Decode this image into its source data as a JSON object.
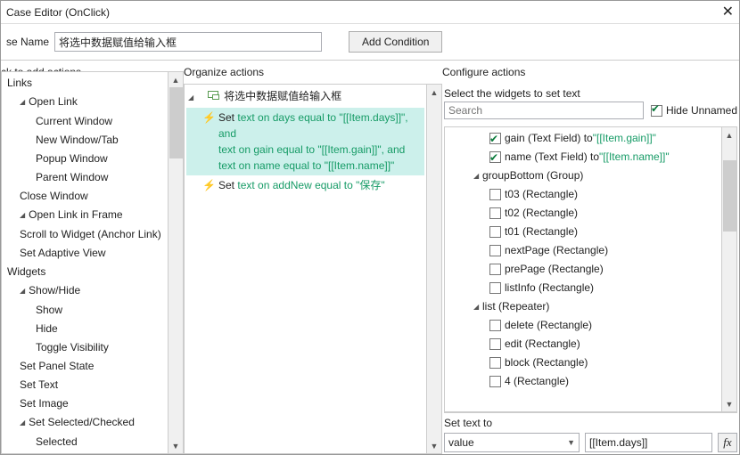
{
  "window": {
    "title": "Case Editor (OnClick)"
  },
  "caseRow": {
    "label": "se Name",
    "value": "将选中数据赋值给输入框",
    "addCondition": "Add Condition"
  },
  "left": {
    "heading": "ck to add actions",
    "groups": [
      {
        "label": "Links",
        "lvl": 1
      },
      {
        "label": "Open Link",
        "lvl": 2,
        "children": true
      },
      {
        "label": "Current Window",
        "lvl": 3
      },
      {
        "label": "New Window/Tab",
        "lvl": 3
      },
      {
        "label": "Popup Window",
        "lvl": 3
      },
      {
        "label": "Parent Window",
        "lvl": 3
      },
      {
        "label": "Close Window",
        "lvl": 2
      },
      {
        "label": "Open Link in Frame",
        "lvl": 2,
        "children": true
      },
      {
        "label": "Scroll to Widget (Anchor Link)",
        "lvl": 2
      },
      {
        "label": "Set Adaptive View",
        "lvl": 2
      },
      {
        "label": "Widgets",
        "lvl": 1
      },
      {
        "label": "Show/Hide",
        "lvl": 2,
        "children": true
      },
      {
        "label": "Show",
        "lvl": 3
      },
      {
        "label": "Hide",
        "lvl": 3
      },
      {
        "label": "Toggle Visibility",
        "lvl": 3
      },
      {
        "label": "Set Panel State",
        "lvl": 2
      },
      {
        "label": "Set Text",
        "lvl": 2
      },
      {
        "label": "Set Image",
        "lvl": 2
      },
      {
        "label": "Set Selected/Checked",
        "lvl": 2,
        "children": true
      },
      {
        "label": "Selected",
        "lvl": 3
      }
    ]
  },
  "mid": {
    "heading": "Organize actions",
    "caseName": "将选中数据赋值给输入框",
    "items": [
      {
        "sel": true,
        "pre": "Set ",
        "lines": [
          "text on days equal to \"[[Item.days]]\", and",
          "text on gain equal to \"[[Item.gain]]\", and",
          "text on name equal to \"[[Item.name]]\""
        ]
      },
      {
        "sel": false,
        "pre": "Set ",
        "lines": [
          "text on addNew equal to \"保存\""
        ]
      }
    ]
  },
  "right": {
    "heading": "Configure actions",
    "sub1": "Select the widgets to set text",
    "searchPlaceholder": "Search",
    "hideUnnamed": "Hide Unnamed",
    "widgets": [
      {
        "type": "row",
        "lvl": 2,
        "checked": true,
        "pre": "gain (Text Field) to ",
        "vq": "\"[[Item.gain]]\""
      },
      {
        "type": "row",
        "lvl": 2,
        "checked": true,
        "pre": "name (Text Field) to ",
        "vq": "\"[[Item.name]]\""
      },
      {
        "type": "group",
        "lvl": 1,
        "label": "groupBottom (Group)"
      },
      {
        "type": "row",
        "lvl": 2,
        "checked": false,
        "pre": "t03 (Rectangle)"
      },
      {
        "type": "row",
        "lvl": 2,
        "checked": false,
        "pre": "t02 (Rectangle)"
      },
      {
        "type": "row",
        "lvl": 2,
        "checked": false,
        "pre": "t01 (Rectangle)"
      },
      {
        "type": "row",
        "lvl": 2,
        "checked": false,
        "pre": "nextPage (Rectangle)"
      },
      {
        "type": "row",
        "lvl": 2,
        "checked": false,
        "pre": "prePage (Rectangle)"
      },
      {
        "type": "row",
        "lvl": 2,
        "checked": false,
        "pre": "listInfo (Rectangle)"
      },
      {
        "type": "group",
        "lvl": 1,
        "label": "list (Repeater)"
      },
      {
        "type": "row",
        "lvl": 2,
        "checked": false,
        "pre": "delete (Rectangle)"
      },
      {
        "type": "row",
        "lvl": 2,
        "checked": false,
        "pre": "edit (Rectangle)"
      },
      {
        "type": "row",
        "lvl": 2,
        "checked": false,
        "pre": "block (Rectangle)"
      },
      {
        "type": "row",
        "lvl": 2,
        "checked": false,
        "pre": "4 (Rectangle)"
      }
    ],
    "setTextLabel": "Set text to",
    "selectValue": "value",
    "textValue": "[[Item.days]]",
    "fx": "fx"
  }
}
